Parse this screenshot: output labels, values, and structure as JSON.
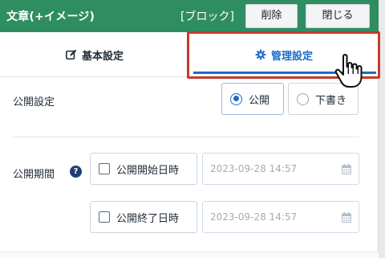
{
  "header": {
    "title": "文章(+イメージ)",
    "block_tag": "[ブロック]",
    "delete_label": "削除",
    "close_label": "閉じる"
  },
  "tabs": [
    {
      "label": "基本設定",
      "icon": "edit-icon",
      "active": false
    },
    {
      "label": "管理設定",
      "icon": "gear-icon",
      "active": true
    }
  ],
  "publish": {
    "label": "公開設定",
    "options": [
      {
        "label": "公開",
        "selected": true
      },
      {
        "label": "下書き",
        "selected": false
      }
    ]
  },
  "period": {
    "label": "公開期間",
    "help_icon": "question-circle-icon",
    "start": {
      "checkbox_label": "公開開始日時",
      "checked": false,
      "placeholder": "2023-09-28 14:57"
    },
    "end": {
      "checkbox_label": "公開終了日時",
      "checked": false,
      "placeholder": "2023-09-28 14:57"
    }
  },
  "colors": {
    "header_bg": "#2f8d62",
    "accent": "#1c6bc7",
    "highlight_border": "#c53b2d"
  },
  "cursor": "pointer-hand-icon"
}
